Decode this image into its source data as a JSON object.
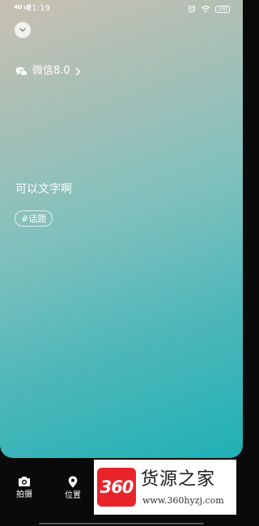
{
  "status_bar": {
    "signal_text": "4G ull",
    "time": "21:19",
    "battery": "100",
    "icons": [
      "alarm-icon",
      "wifi-icon",
      "battery-icon"
    ]
  },
  "header": {
    "collapse_icon": "chevron-down-icon"
  },
  "share": {
    "label": "微信8.0",
    "icon": "wechat-icon",
    "arrow_icon": "chevron-right-icon"
  },
  "post": {
    "text": "可以文字啊",
    "topic": "#话题"
  },
  "toolbar": {
    "items": [
      {
        "label": "拍摄",
        "icon": "camera-icon"
      },
      {
        "label": "位置",
        "icon": "location-pin-icon"
      }
    ]
  },
  "watermark": {
    "logo_text": "360",
    "title": "货源之家",
    "url": "www.360hyzj.com"
  },
  "colors": {
    "gradient_top": "#c9c0b2",
    "gradient_bottom": "#1fb1b6",
    "bar_bg": "#0a0a0a",
    "logo_red": "#e8242a"
  }
}
